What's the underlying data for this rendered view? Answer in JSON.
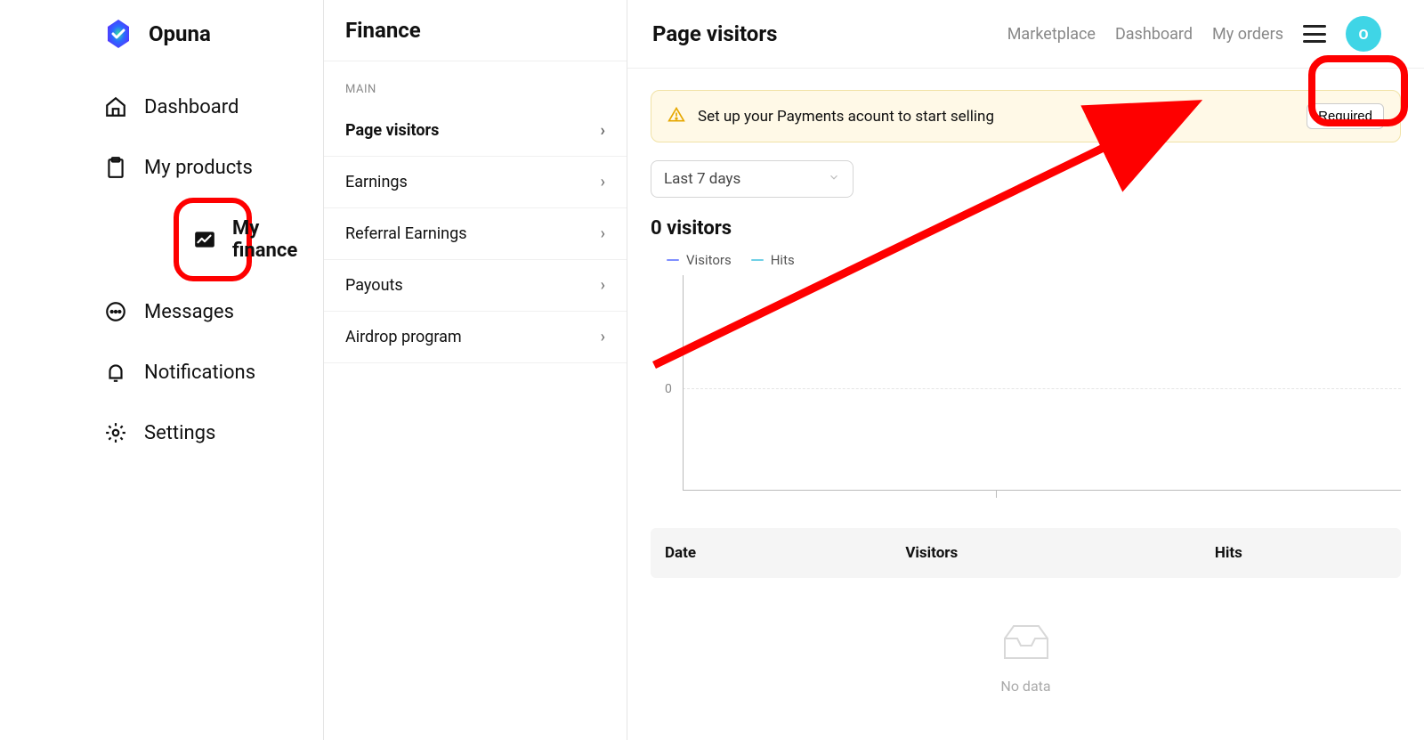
{
  "brand": {
    "name": "Opuna"
  },
  "sidebar": {
    "items": [
      {
        "label": "Dashboard",
        "icon": "home-icon",
        "active": false
      },
      {
        "label": "My products",
        "icon": "clipboard-icon",
        "active": false
      },
      {
        "label": "My finance",
        "icon": "chart-icon",
        "active": true
      },
      {
        "label": "Messages",
        "icon": "chat-icon",
        "active": false
      },
      {
        "label": "Notifications",
        "icon": "bell-icon",
        "active": false
      },
      {
        "label": "Settings",
        "icon": "gear-icon",
        "active": false
      }
    ]
  },
  "middle": {
    "title": "Finance",
    "section_label": "MAIN",
    "items": [
      {
        "label": "Page visitors",
        "active": true
      },
      {
        "label": "Earnings",
        "active": false
      },
      {
        "label": "Referral Earnings",
        "active": false
      },
      {
        "label": "Payouts",
        "active": false
      },
      {
        "label": "Airdrop program",
        "active": false
      }
    ]
  },
  "main": {
    "title": "Page visitors",
    "nav_links": [
      "Marketplace",
      "Dashboard",
      "My orders"
    ],
    "avatar_letter": "O",
    "alert": {
      "text": "Set up your Payments acount to start selling",
      "button": "Required"
    },
    "dropdown": {
      "selected": "Last 7 days"
    },
    "visitors_heading": "0 visitors",
    "legend": {
      "series1": "Visitors",
      "series2": "Hits",
      "color1": "#7f8fff",
      "color2": "#6fd0e6"
    },
    "y_tick": "0",
    "table": {
      "col_date": "Date",
      "col_visitors": "Visitors",
      "col_hits": "Hits"
    },
    "no_data": "No data"
  },
  "chart_data": {
    "type": "line",
    "title": "0 visitors",
    "xlabel": "",
    "ylabel": "",
    "ylim": [
      0,
      0
    ],
    "categories": [],
    "series": [
      {
        "name": "Visitors",
        "values": []
      },
      {
        "name": "Hits",
        "values": []
      }
    ]
  },
  "annotation": {
    "highlight_colors": "#fe0000"
  }
}
